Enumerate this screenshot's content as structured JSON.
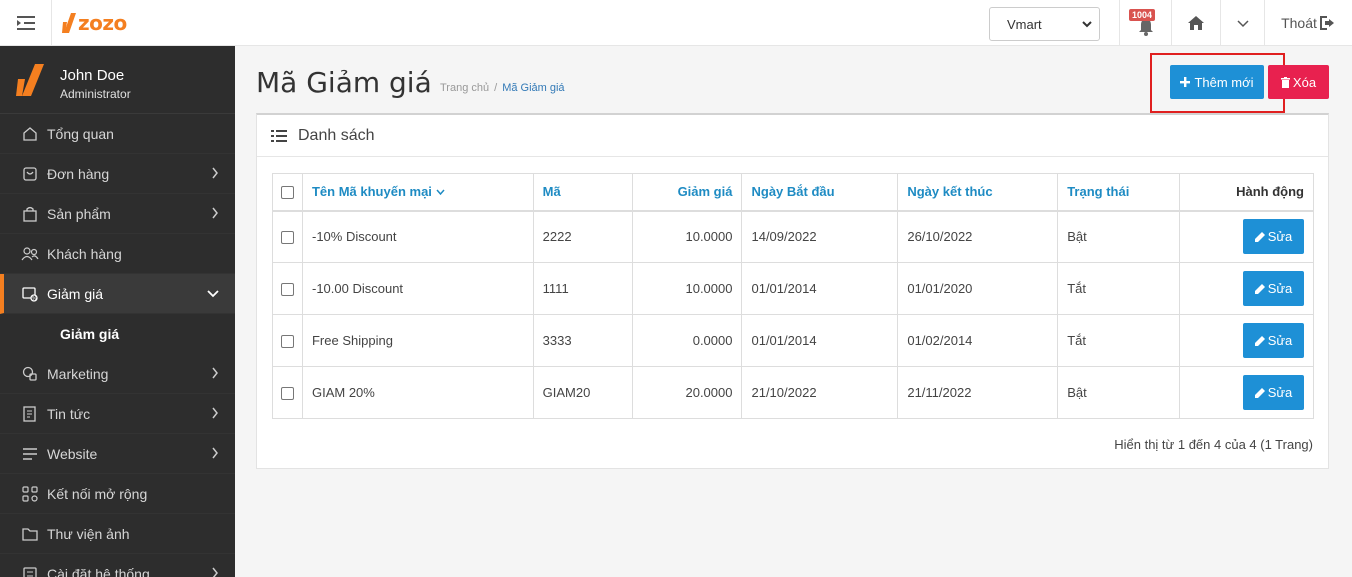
{
  "header": {
    "logo_text": "zozo",
    "store": "Vmart",
    "notifications": "1004",
    "logout": "Thoát"
  },
  "user": {
    "name": "John Doe",
    "role": "Administrator"
  },
  "sidebar": {
    "items": [
      {
        "label": "Tổng quan",
        "icon": "home-outline-icon"
      },
      {
        "label": "Đơn hàng",
        "icon": "order-icon"
      },
      {
        "label": "Sản phẩm",
        "icon": "bag-icon"
      },
      {
        "label": "Khách hàng",
        "icon": "users-icon"
      },
      {
        "label": "Giảm giá",
        "icon": "discount-icon"
      },
      {
        "label": "Giảm giá"
      },
      {
        "label": "Marketing",
        "icon": "marketing-icon"
      },
      {
        "label": "Tin tức",
        "icon": "news-icon"
      },
      {
        "label": "Website",
        "icon": "menu-lines-icon"
      },
      {
        "label": "Kết nối mở rộng",
        "icon": "grid-icon"
      },
      {
        "label": "Thư viện ảnh",
        "icon": "folder-icon"
      },
      {
        "label": "Cài đặt hệ thống",
        "icon": "settings-icon"
      }
    ]
  },
  "page": {
    "title": "Mã Giảm giá",
    "breadcrumb_home": "Trang chủ",
    "breadcrumb_sep": "/",
    "breadcrumb_current": "Mã Giảm giá",
    "add_label": "Thêm mới",
    "delete_label": "Xóa"
  },
  "panel": {
    "title": "Danh sách"
  },
  "table": {
    "headers": [
      "Tên Mã khuyến mại",
      "Mã",
      "Giảm giá",
      "Ngày Bắt đầu",
      "Ngày kết thúc",
      "Trạng thái",
      "Hành động"
    ],
    "edit_label": "Sửa",
    "rows": [
      [
        "-10% Discount",
        "2222",
        "10.0000",
        "14/09/2022",
        "26/10/2022",
        "Bật"
      ],
      [
        "-10.00 Discount",
        "1111",
        "10.0000",
        "01/01/2014",
        "01/01/2020",
        "Tắt"
      ],
      [
        "Free Shipping",
        "3333",
        "0.0000",
        "01/01/2014",
        "01/02/2014",
        "Tắt"
      ],
      [
        "GIAM 20%",
        "GIAM20",
        "20.0000",
        "21/10/2022",
        "21/11/2022",
        "Bật"
      ]
    ]
  },
  "pagination": {
    "summary": "Hiển thị từ 1 đến 4 của 4 (1 Trang)"
  },
  "colors": {
    "accent": "#f47f20",
    "primary": "#1e90d6",
    "danger": "#e8214f",
    "sidebar": "#2d2d2d"
  }
}
